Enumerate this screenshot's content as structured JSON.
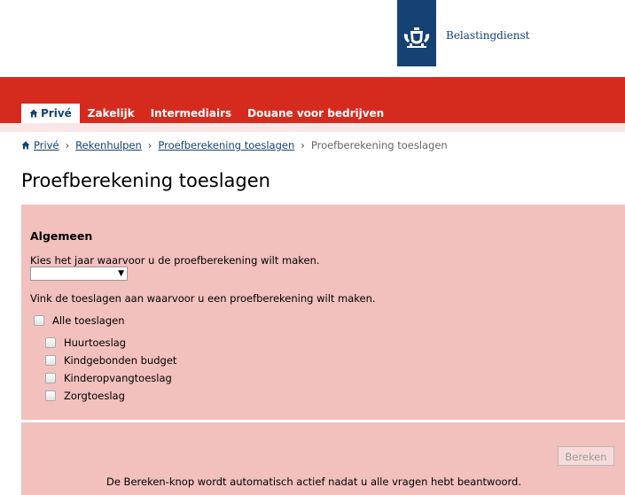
{
  "header": {
    "brand": "Belastingdienst",
    "logo_icon": "rijksoverheid-coat-of-arms-icon",
    "colors": {
      "red": "#d52b1e",
      "blue": "#154273",
      "panel": "#f2c0bd"
    }
  },
  "nav": {
    "items": [
      {
        "label": "Privé",
        "icon": "home-icon",
        "active": true
      },
      {
        "label": "Zakelijk"
      },
      {
        "label": "Intermediairs"
      },
      {
        "label": "Douane voor bedrijven"
      }
    ]
  },
  "breadcrumb": {
    "items": [
      "Privé",
      "Rekenhulpen",
      "Proefberekening toeslagen"
    ],
    "current": "Proefberekening toeslagen"
  },
  "page": {
    "title": "Proefberekening toeslagen"
  },
  "form": {
    "section_title": "Algemeen",
    "year_question": "Kies het jaar waarvoor u de proefberekening wilt maken.",
    "year_value": "",
    "benefits_question": "Vink de toeslagen aan waarvoor u een proefberekening wilt maken.",
    "all_label": "Alle toeslagen",
    "options": [
      "Huurtoeslag",
      "Kindgebonden budget",
      "Kinderopvangtoeslag",
      "Zorgtoeslag"
    ]
  },
  "footer": {
    "calculate_label": "Bereken",
    "note": "De Bereken-knop wordt automatisch actief nadat u alle vragen hebt beantwoord."
  }
}
